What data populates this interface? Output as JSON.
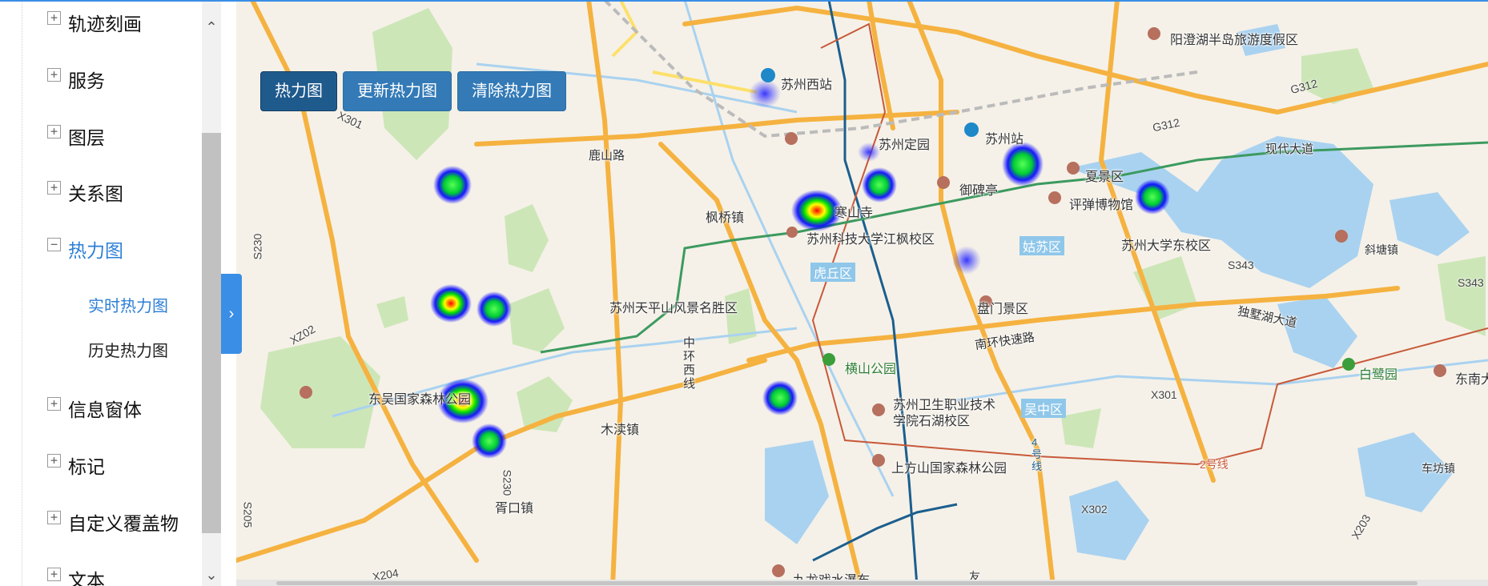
{
  "sidebar": {
    "items": [
      {
        "label": "轨迹刻画",
        "expander": "+"
      },
      {
        "label": "服务",
        "expander": "+"
      },
      {
        "label": "图层",
        "expander": "+"
      },
      {
        "label": "关系图",
        "expander": "+"
      },
      {
        "label": "热力图",
        "expander": "−"
      },
      {
        "label": "信息窗体",
        "expander": "+"
      },
      {
        "label": "标记",
        "expander": "+"
      },
      {
        "label": "自定义覆盖物",
        "expander": "+"
      },
      {
        "label": "文本",
        "expander": "+"
      }
    ],
    "subitems": [
      {
        "label": "实时热力图"
      },
      {
        "label": "历史热力图"
      }
    ],
    "scroll_up": "⌃",
    "scroll_down": "⌄",
    "collapse": "›"
  },
  "toolbar": {
    "heatmap": "热力图",
    "update": "更新热力图",
    "clear": "清除热力图"
  },
  "map": {
    "places": {
      "yangcheng": "阳澄湖半岛旅游度假区",
      "suzhou_west": "苏州西站",
      "suzhou_station": "苏州站",
      "dingyuan": "苏州定园",
      "yubeiting": "御碑亭",
      "xiajing": "夏景区",
      "pingtan": "评弹博物馆",
      "hanshan": "寒山寺",
      "kedajiang": "苏州科技大学江枫校区",
      "gusu": "姑苏区",
      "sudadong": "苏州大学东校区",
      "fengqiao": "枫桥镇",
      "huqiu": "虎丘区",
      "lingyan": "苏州天平山风景名胜区",
      "panmen": "盘门景区",
      "hengshan": "横山公园",
      "dongwu": "东吴国家森林公园",
      "weisheng": "苏州卫生职业技术学院石湖校区",
      "mudu": "木渎镇",
      "shangfang": "上方山国家森林公园",
      "xukou": "胥口镇",
      "jiulong": "九龙戏水瀑布",
      "wuzhong": "吴中区",
      "xietang": "斜塘镇",
      "bailuyuan": "白鹭园",
      "dongnan": "东南大",
      "chefang": "车坊镇",
      "lushan": "鹿山路",
      "zhonghuan": "中环西线",
      "nanhuan": "南环快速路",
      "dushuhu": "独墅湖大道",
      "xiandai": "现代大道",
      "line4": "4号线",
      "line2": "2号线",
      "you": "友"
    },
    "roads": {
      "x301a": "X301",
      "x301b": "X301",
      "x302": "X302",
      "x204": "X204",
      "x203": "X203",
      "s230a": "S230",
      "s230b": "S230",
      "s343a": "S343",
      "s343b": "S343",
      "g312a": "G312",
      "g312b": "G312",
      "xz02": "XZ02",
      "s205": "S205"
    }
  }
}
